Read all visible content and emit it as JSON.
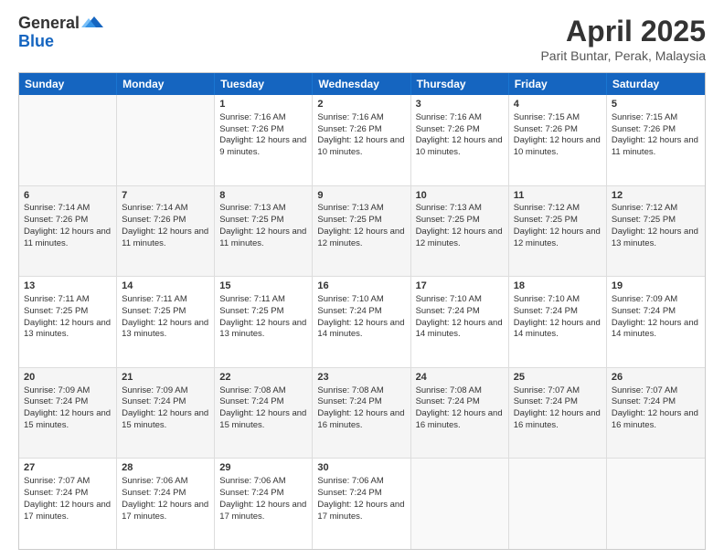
{
  "logo": {
    "general": "General",
    "blue": "Blue"
  },
  "header": {
    "title": "April 2025",
    "subtitle": "Parit Buntar, Perak, Malaysia"
  },
  "weekdays": [
    "Sunday",
    "Monday",
    "Tuesday",
    "Wednesday",
    "Thursday",
    "Friday",
    "Saturday"
  ],
  "rows": [
    [
      {
        "day": "",
        "sunrise": "",
        "sunset": "",
        "daylight": ""
      },
      {
        "day": "",
        "sunrise": "",
        "sunset": "",
        "daylight": ""
      },
      {
        "day": "1",
        "sunrise": "Sunrise: 7:16 AM",
        "sunset": "Sunset: 7:26 PM",
        "daylight": "Daylight: 12 hours and 9 minutes."
      },
      {
        "day": "2",
        "sunrise": "Sunrise: 7:16 AM",
        "sunset": "Sunset: 7:26 PM",
        "daylight": "Daylight: 12 hours and 10 minutes."
      },
      {
        "day": "3",
        "sunrise": "Sunrise: 7:16 AM",
        "sunset": "Sunset: 7:26 PM",
        "daylight": "Daylight: 12 hours and 10 minutes."
      },
      {
        "day": "4",
        "sunrise": "Sunrise: 7:15 AM",
        "sunset": "Sunset: 7:26 PM",
        "daylight": "Daylight: 12 hours and 10 minutes."
      },
      {
        "day": "5",
        "sunrise": "Sunrise: 7:15 AM",
        "sunset": "Sunset: 7:26 PM",
        "daylight": "Daylight: 12 hours and 11 minutes."
      }
    ],
    [
      {
        "day": "6",
        "sunrise": "Sunrise: 7:14 AM",
        "sunset": "Sunset: 7:26 PM",
        "daylight": "Daylight: 12 hours and 11 minutes."
      },
      {
        "day": "7",
        "sunrise": "Sunrise: 7:14 AM",
        "sunset": "Sunset: 7:26 PM",
        "daylight": "Daylight: 12 hours and 11 minutes."
      },
      {
        "day": "8",
        "sunrise": "Sunrise: 7:13 AM",
        "sunset": "Sunset: 7:25 PM",
        "daylight": "Daylight: 12 hours and 11 minutes."
      },
      {
        "day": "9",
        "sunrise": "Sunrise: 7:13 AM",
        "sunset": "Sunset: 7:25 PM",
        "daylight": "Daylight: 12 hours and 12 minutes."
      },
      {
        "day": "10",
        "sunrise": "Sunrise: 7:13 AM",
        "sunset": "Sunset: 7:25 PM",
        "daylight": "Daylight: 12 hours and 12 minutes."
      },
      {
        "day": "11",
        "sunrise": "Sunrise: 7:12 AM",
        "sunset": "Sunset: 7:25 PM",
        "daylight": "Daylight: 12 hours and 12 minutes."
      },
      {
        "day": "12",
        "sunrise": "Sunrise: 7:12 AM",
        "sunset": "Sunset: 7:25 PM",
        "daylight": "Daylight: 12 hours and 13 minutes."
      }
    ],
    [
      {
        "day": "13",
        "sunrise": "Sunrise: 7:11 AM",
        "sunset": "Sunset: 7:25 PM",
        "daylight": "Daylight: 12 hours and 13 minutes."
      },
      {
        "day": "14",
        "sunrise": "Sunrise: 7:11 AM",
        "sunset": "Sunset: 7:25 PM",
        "daylight": "Daylight: 12 hours and 13 minutes."
      },
      {
        "day": "15",
        "sunrise": "Sunrise: 7:11 AM",
        "sunset": "Sunset: 7:25 PM",
        "daylight": "Daylight: 12 hours and 13 minutes."
      },
      {
        "day": "16",
        "sunrise": "Sunrise: 7:10 AM",
        "sunset": "Sunset: 7:24 PM",
        "daylight": "Daylight: 12 hours and 14 minutes."
      },
      {
        "day": "17",
        "sunrise": "Sunrise: 7:10 AM",
        "sunset": "Sunset: 7:24 PM",
        "daylight": "Daylight: 12 hours and 14 minutes."
      },
      {
        "day": "18",
        "sunrise": "Sunrise: 7:10 AM",
        "sunset": "Sunset: 7:24 PM",
        "daylight": "Daylight: 12 hours and 14 minutes."
      },
      {
        "day": "19",
        "sunrise": "Sunrise: 7:09 AM",
        "sunset": "Sunset: 7:24 PM",
        "daylight": "Daylight: 12 hours and 14 minutes."
      }
    ],
    [
      {
        "day": "20",
        "sunrise": "Sunrise: 7:09 AM",
        "sunset": "Sunset: 7:24 PM",
        "daylight": "Daylight: 12 hours and 15 minutes."
      },
      {
        "day": "21",
        "sunrise": "Sunrise: 7:09 AM",
        "sunset": "Sunset: 7:24 PM",
        "daylight": "Daylight: 12 hours and 15 minutes."
      },
      {
        "day": "22",
        "sunrise": "Sunrise: 7:08 AM",
        "sunset": "Sunset: 7:24 PM",
        "daylight": "Daylight: 12 hours and 15 minutes."
      },
      {
        "day": "23",
        "sunrise": "Sunrise: 7:08 AM",
        "sunset": "Sunset: 7:24 PM",
        "daylight": "Daylight: 12 hours and 16 minutes."
      },
      {
        "day": "24",
        "sunrise": "Sunrise: 7:08 AM",
        "sunset": "Sunset: 7:24 PM",
        "daylight": "Daylight: 12 hours and 16 minutes."
      },
      {
        "day": "25",
        "sunrise": "Sunrise: 7:07 AM",
        "sunset": "Sunset: 7:24 PM",
        "daylight": "Daylight: 12 hours and 16 minutes."
      },
      {
        "day": "26",
        "sunrise": "Sunrise: 7:07 AM",
        "sunset": "Sunset: 7:24 PM",
        "daylight": "Daylight: 12 hours and 16 minutes."
      }
    ],
    [
      {
        "day": "27",
        "sunrise": "Sunrise: 7:07 AM",
        "sunset": "Sunset: 7:24 PM",
        "daylight": "Daylight: 12 hours and 17 minutes."
      },
      {
        "day": "28",
        "sunrise": "Sunrise: 7:06 AM",
        "sunset": "Sunset: 7:24 PM",
        "daylight": "Daylight: 12 hours and 17 minutes."
      },
      {
        "day": "29",
        "sunrise": "Sunrise: 7:06 AM",
        "sunset": "Sunset: 7:24 PM",
        "daylight": "Daylight: 12 hours and 17 minutes."
      },
      {
        "day": "30",
        "sunrise": "Sunrise: 7:06 AM",
        "sunset": "Sunset: 7:24 PM",
        "daylight": "Daylight: 12 hours and 17 minutes."
      },
      {
        "day": "",
        "sunrise": "",
        "sunset": "",
        "daylight": ""
      },
      {
        "day": "",
        "sunrise": "",
        "sunset": "",
        "daylight": ""
      },
      {
        "day": "",
        "sunrise": "",
        "sunset": "",
        "daylight": ""
      }
    ]
  ]
}
